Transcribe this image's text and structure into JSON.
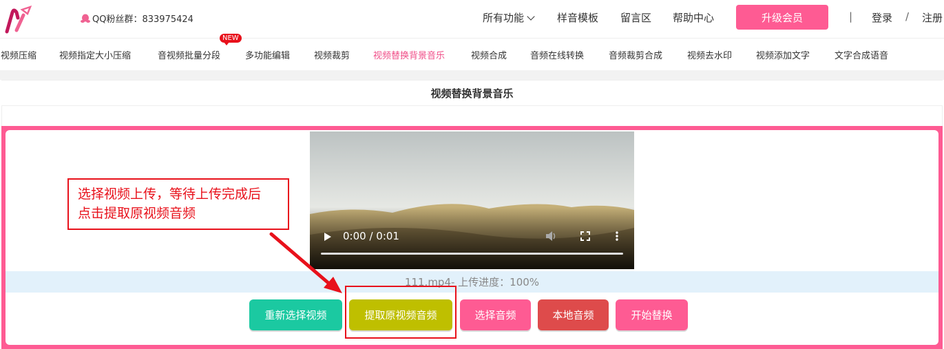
{
  "header": {
    "qq_label": "QQ粉丝群：833975424",
    "nav": [
      "所有功能",
      "样音模板",
      "留言区",
      "帮助中心"
    ],
    "upgrade_label": "升级会员",
    "divider": "|",
    "login": "登录",
    "slash": "/",
    "register": "注册"
  },
  "tools": {
    "items": [
      "视频压缩",
      "视频指定大小压缩",
      "音视频批量分段",
      "多功能编辑",
      "视频裁剪",
      "视频替换背景音乐",
      "视频合成",
      "音频在线转换",
      "音频裁剪合成",
      "视频去水印",
      "视频添加文字",
      "文字合成语音"
    ],
    "active_index": 5,
    "new_badge": "NEW"
  },
  "page": {
    "title": "视频替换背景音乐"
  },
  "player": {
    "time": "0:00 / 0:01",
    "progress": 0
  },
  "upload": {
    "status": "111.mp4- 上传进度：100%",
    "progress_percent": 100
  },
  "buttons": {
    "reselect": "重新选择视频",
    "extract": "提取原视频音频",
    "choose_audio": "选择音频",
    "local_audio": "本地音频",
    "start": "开始替换"
  },
  "callout": {
    "line1": "选择视频上传，等待上传完成后",
    "line2": "点击提取原视频音频"
  },
  "colors": {
    "accent_pink": "#fe5b93",
    "teal": "#1bc9a1",
    "olive": "#bfbf00",
    "red_btn": "#de4b4b",
    "annotation_red": "#e8111b"
  },
  "icons": {
    "logo": "brand-logo-icon",
    "qq": "qq-penguin-icon",
    "play": "play-icon",
    "volume": "volume-icon",
    "fullscreen": "fullscreen-icon",
    "more": "more-vertical-icon"
  }
}
